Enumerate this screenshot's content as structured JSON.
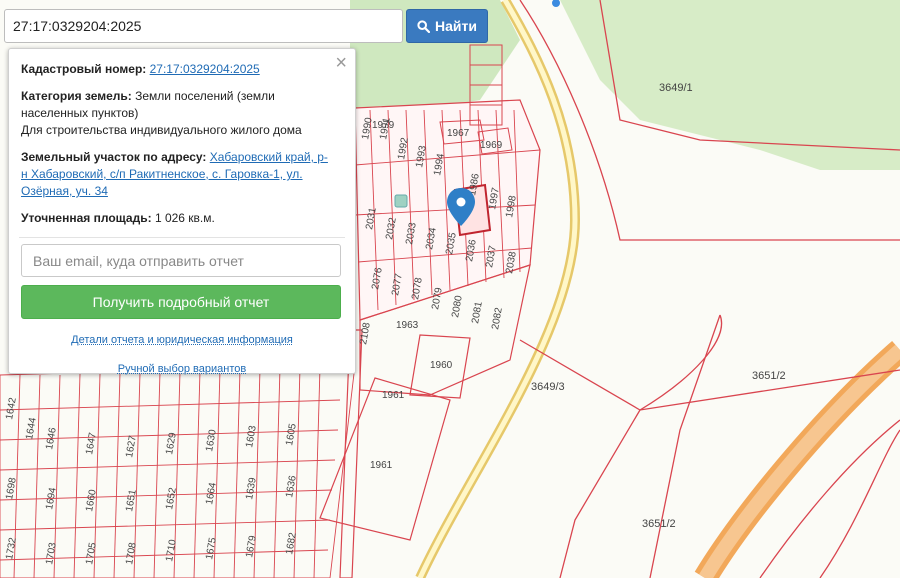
{
  "search": {
    "value": "27:17:0329204:2025",
    "button_label": "Найти"
  },
  "panel": {
    "cadastral_label": "Кадастровый номер:",
    "cadastral_value": "27:17:0329204:2025",
    "category_label": "Категория земель:",
    "category_value": "Земли поселений (земли населенных пунктов)",
    "usage_value": "Для строительства индивидуального жилого дома",
    "address_label": "Земельный участок по адресу:",
    "address_value": "Хабаровский край, р-н Хабаровский, с/п Ракитненское, с. Гаровка-1, ул. Озёрная, уч. 34",
    "area_label": "Уточненная площадь:",
    "area_value": "1 026 кв.м.",
    "email_placeholder": "Ваш email, куда отправить отчет",
    "report_button": "Получить подробный отчет",
    "details_link": "Детали отчета и юридическая информация",
    "manual_link": "Ручной выбор вариантов",
    "close_symbol": "×"
  },
  "map": {
    "labels": {
      "big_3649_1": "3649/1",
      "big_3649_3": "3649/3",
      "big_3651_2a": "3651/2",
      "big_3651_2b": "3651/2",
      "lot_1961a": "1961",
      "lot_1961b": "1961",
      "lot_1960": "1960",
      "lot_1963": "1963",
      "lot_1967": "1967",
      "lot_1969": "1969",
      "lot_1979": "1979",
      "lot_2108": "2108"
    },
    "colors": {
      "boundary": "#d9454f",
      "road": "#f2a85a",
      "greenery": "#cfe8bf",
      "marker": "#2e7fc7"
    }
  }
}
